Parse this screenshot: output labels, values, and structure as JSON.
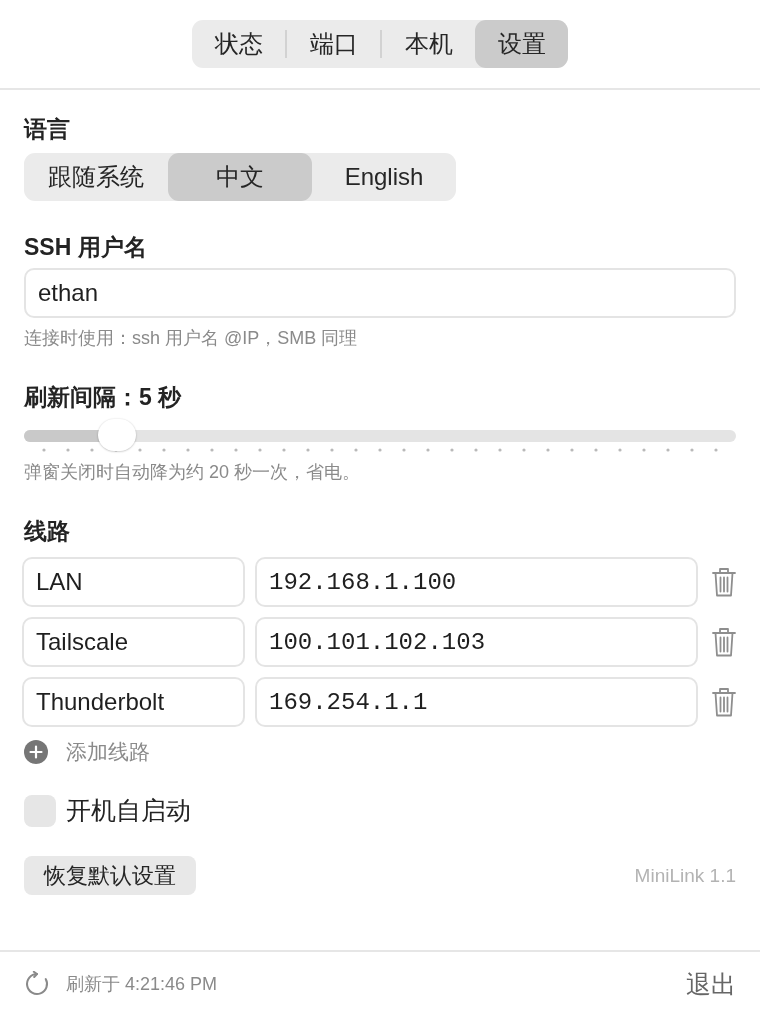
{
  "tabs": [
    {
      "label": "状态",
      "selected": false
    },
    {
      "label": "端口",
      "selected": false
    },
    {
      "label": "本机",
      "selected": false
    },
    {
      "label": "设置",
      "selected": true
    }
  ],
  "language": {
    "title": "语言",
    "options": [
      {
        "label": "跟随系统",
        "selected": false
      },
      {
        "label": "中文",
        "selected": true
      },
      {
        "label": "English",
        "selected": false
      }
    ]
  },
  "ssh_username": {
    "title": "SSH 用户名",
    "value": "ethan",
    "hint": "连接时使用：ssh 用户名 @IP，SMB 同理"
  },
  "refresh_interval": {
    "title": "刷新间隔：5 秒",
    "level": 0.11,
    "hint": "弹窗关闭时自动降为约 20 秒一次，省电。"
  },
  "routes": {
    "title": "线路",
    "items": [
      {
        "name": "LAN",
        "address": "192.168.1.100"
      },
      {
        "name": "Tailscale",
        "address": "100.101.102.103"
      },
      {
        "name": "Thunderbolt",
        "address": "169.254.1.1"
      }
    ],
    "add_label": "添加线路"
  },
  "launch_at_login": {
    "label": "开机自启动",
    "checked": false
  },
  "reset_button": "恢复默认设置",
  "version": "MiniLink 1.1",
  "status_bar": {
    "refreshed": "刷新于 4:21:46 PM",
    "quit": "退出"
  }
}
